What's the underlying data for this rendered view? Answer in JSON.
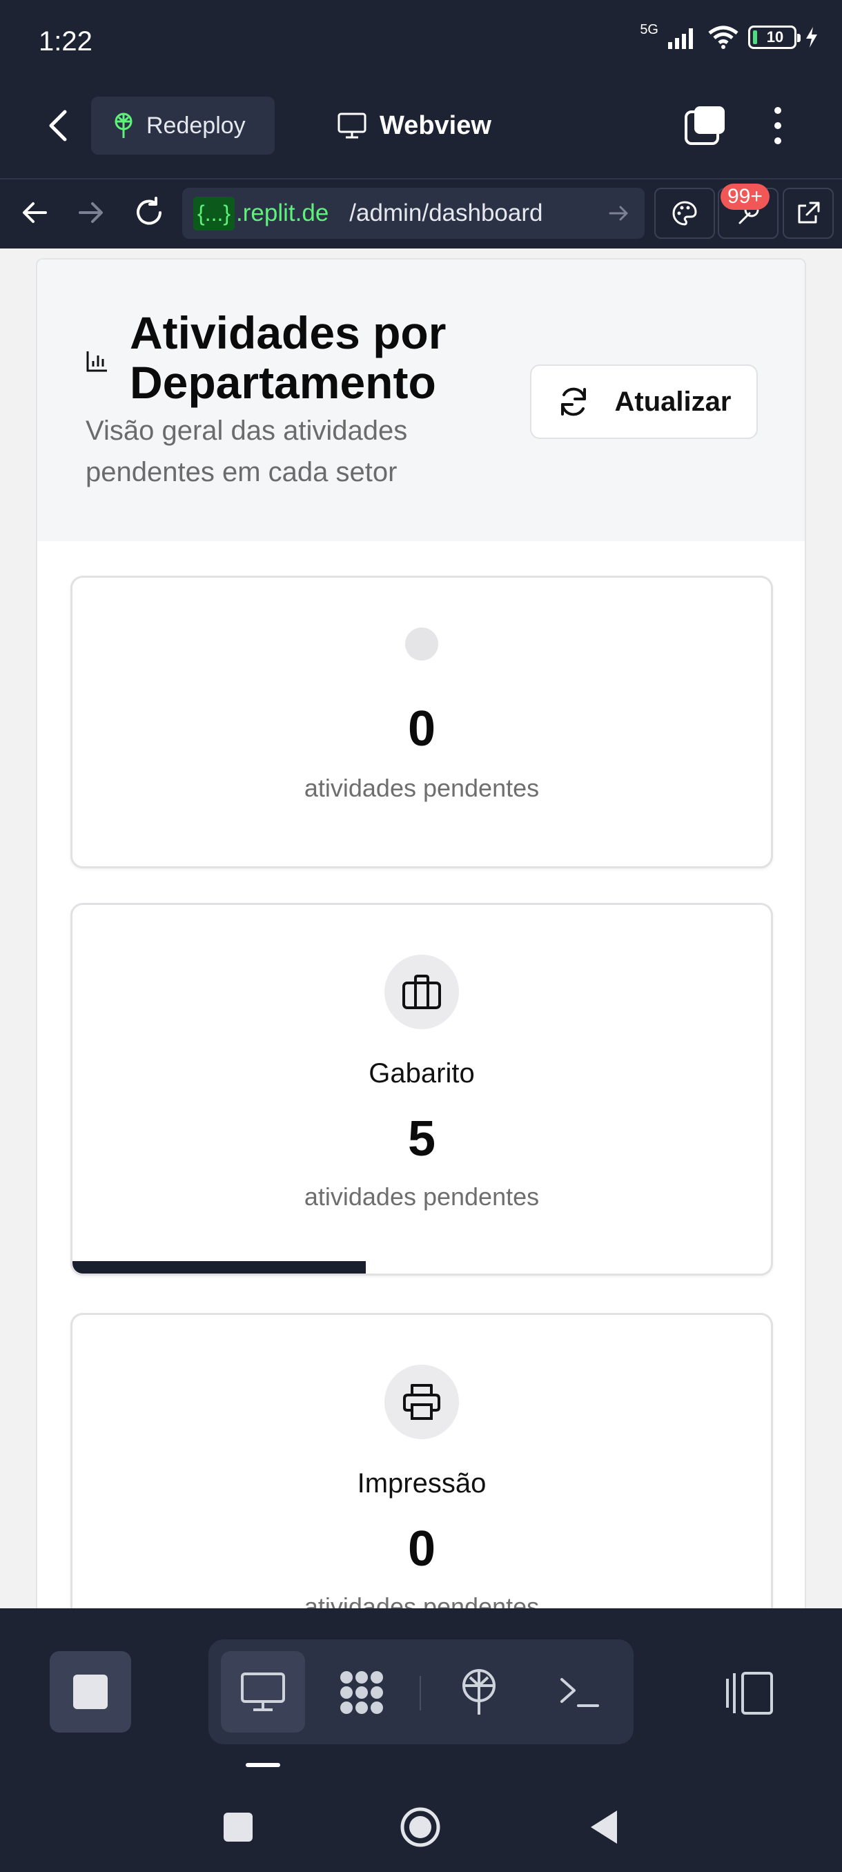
{
  "status_bar": {
    "time": "1:22",
    "network": "5G",
    "battery": "10"
  },
  "header": {
    "redeploy_label": "Redeploy",
    "webview_label": "Webview"
  },
  "browser": {
    "url_badge": "{...}",
    "url_domain": ".replit.de",
    "url_path": "/admin/dashboard",
    "badge_count": "99+"
  },
  "dashboard": {
    "title": "Atividades por Departamento",
    "description": "Visão geral das atividades pendentes em cada setor",
    "refresh_label": "Atualizar",
    "cards": [
      {
        "name": "",
        "count": "0",
        "subtitle": "atividades pendentes",
        "icon": "placeholder-dot"
      },
      {
        "name": "Gabarito",
        "count": "5",
        "subtitle": "atividades pendentes",
        "icon": "briefcase-icon",
        "progress": 0.42
      },
      {
        "name": "Impressão",
        "count": "0",
        "subtitle": "atividades pendentes",
        "icon": "printer-icon"
      }
    ]
  },
  "colors": {
    "accent_green": "#5ef27a",
    "dark_bg": "#1d2333",
    "progress": "#1a1f2e",
    "badge": "#f25757"
  }
}
